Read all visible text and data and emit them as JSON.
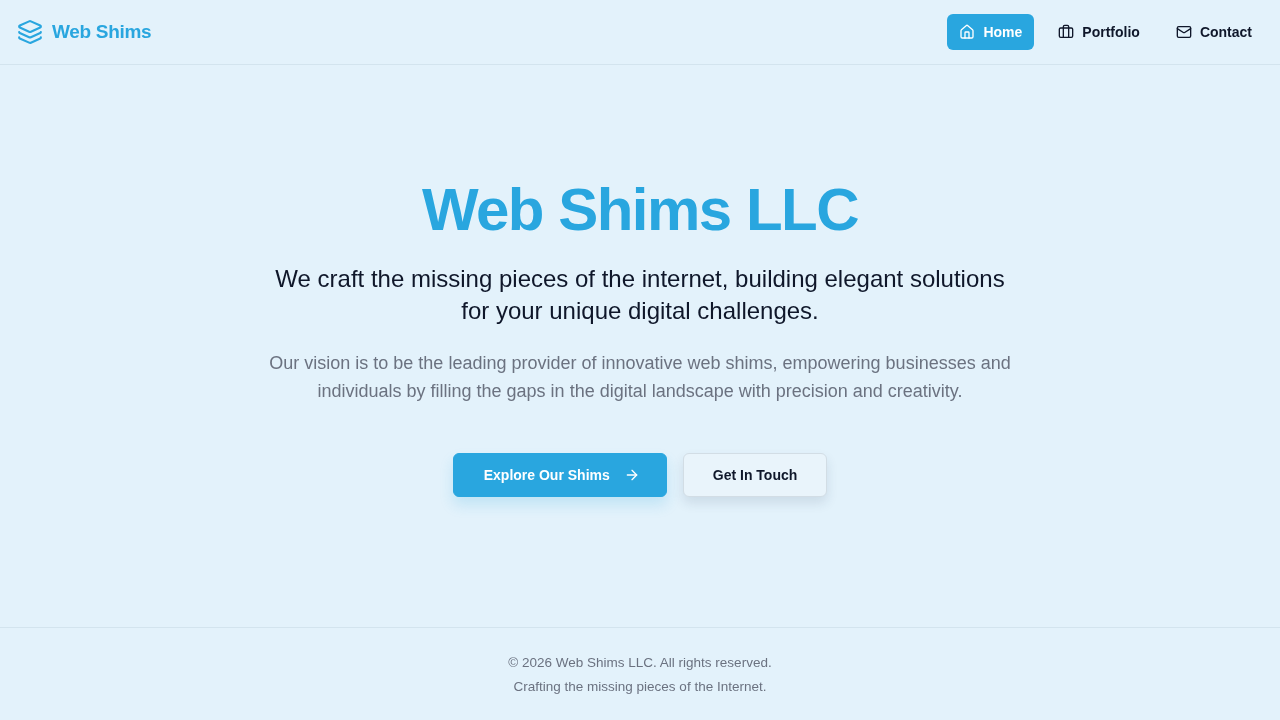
{
  "header": {
    "logo": {
      "text": "Web Shims"
    },
    "nav": [
      {
        "label": "Home",
        "selected": true
      },
      {
        "label": "Portfolio",
        "selected": false
      },
      {
        "label": "Contact",
        "selected": false
      }
    ]
  },
  "hero": {
    "title": "Web Shims LLC",
    "subtitle": "We craft the missing pieces of the internet, building elegant solutions for your unique digital challenges.",
    "description": "Our vision is to be the leading provider of innovative web shims, empowering businesses and individuals by filling the gaps in the digital landscape with precision and creativity.",
    "buttons": [
      {
        "label": "Explore Our Shims",
        "kind": "primary"
      },
      {
        "label": "Get In Touch",
        "kind": "secondary"
      }
    ]
  },
  "footer": {
    "lines": [
      "© 2026 Web Shims LLC. All rights reserved.",
      "Crafting the missing pieces of the Internet."
    ]
  }
}
